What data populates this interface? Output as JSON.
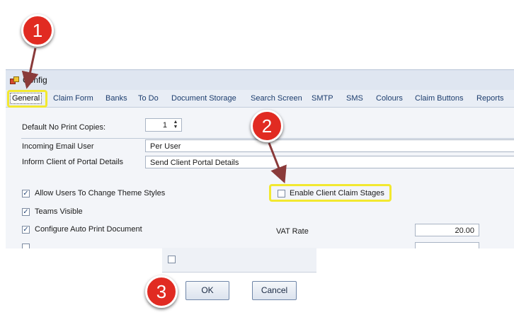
{
  "window": {
    "title": "Config"
  },
  "tabs": [
    {
      "label": "General"
    },
    {
      "label": "Claim Form"
    },
    {
      "label": "Banks"
    },
    {
      "label": "To Do"
    },
    {
      "label": "Document Storage"
    },
    {
      "label": "Search Screen"
    },
    {
      "label": "SMTP"
    },
    {
      "label": "SMS"
    },
    {
      "label": "Colours"
    },
    {
      "label": "Claim Buttons"
    },
    {
      "label": "Reports"
    }
  ],
  "general": {
    "print_copies": {
      "label": "Default No Print Copies:",
      "value": "1"
    },
    "incoming_email_user": {
      "label": "Incoming Email User",
      "value": "Per User"
    },
    "inform_client_portal": {
      "label": "Inform Client of Portal Details",
      "value": "Send Client Portal Details"
    },
    "checkboxes": [
      {
        "label": "Allow Users To Change Theme Styles",
        "checked": true
      },
      {
        "label": "Teams Visible",
        "checked": true
      },
      {
        "label": "Configure Auto Print Document",
        "checked": true
      },
      {
        "label": "Enable Client Claim Stages",
        "checked": false
      }
    ],
    "vat_rate": {
      "label": "VAT Rate",
      "value": "20.00"
    }
  },
  "callouts": [
    "1",
    "2",
    "3"
  ],
  "buttons": {
    "ok": "OK",
    "cancel": "Cancel"
  },
  "colors": {
    "highlight": "#f2e830",
    "badge": "#e12b22",
    "arrow": "#8a3a3a"
  },
  "icons": {
    "app": "config-app-icon",
    "check": "✓"
  }
}
